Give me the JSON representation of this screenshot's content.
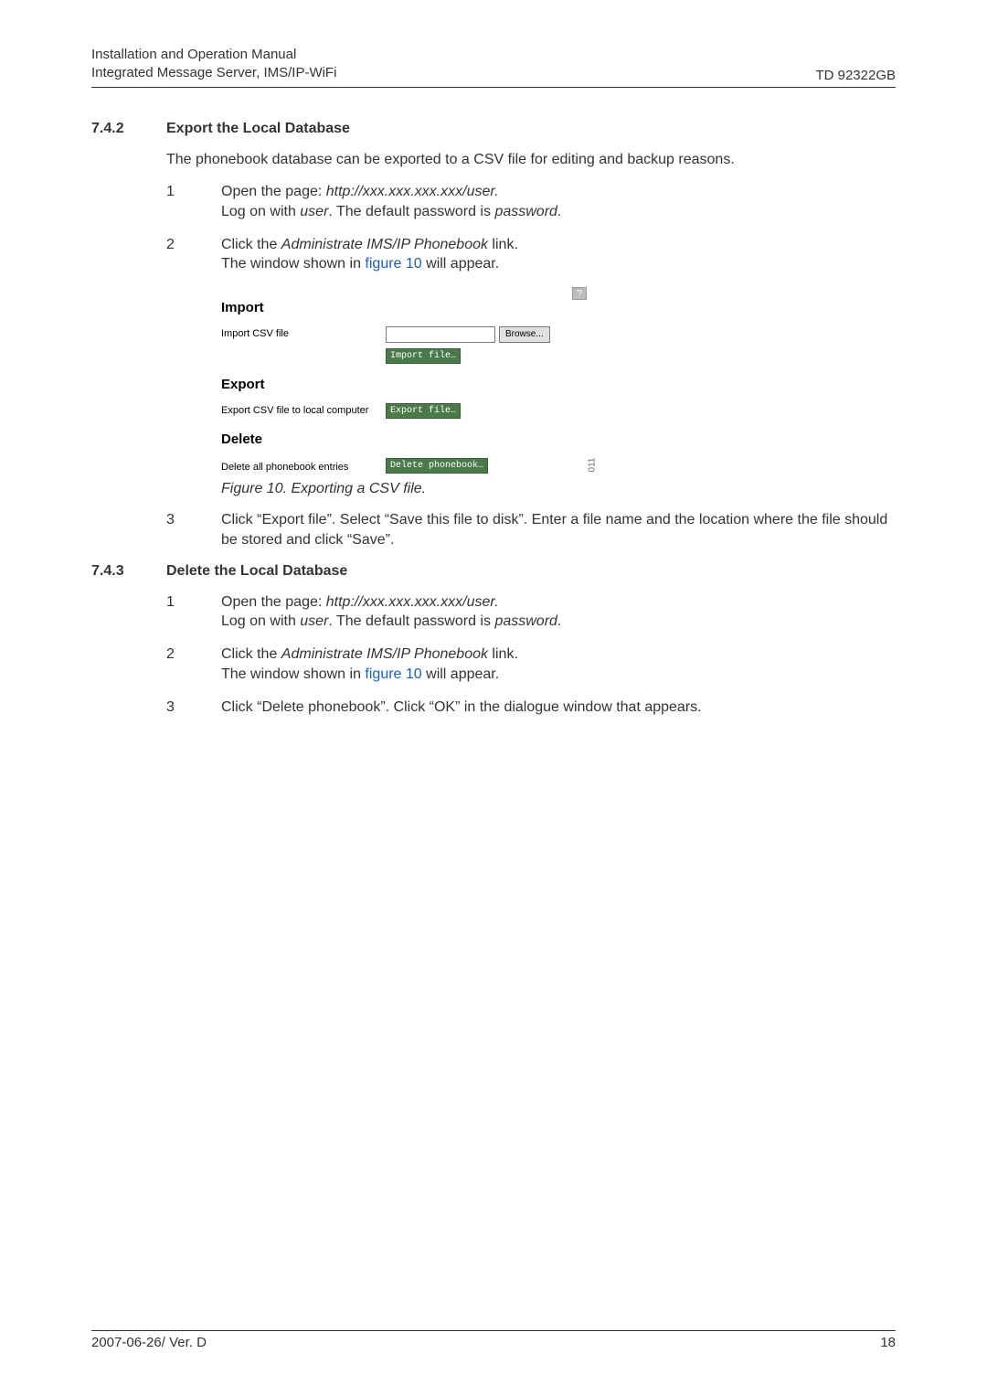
{
  "header": {
    "line1": "Installation and Operation Manual",
    "line2": "Integrated Message Server, IMS/IP-WiFi",
    "right": "TD 92322GB"
  },
  "section742": {
    "number": "7.4.2",
    "title": "Export the Local Database",
    "intro": "The phonebook database can be exported to a CSV file for editing and backup reasons.",
    "steps": [
      {
        "num": "1",
        "parts": {
          "p1": "Open the page: ",
          "url": "http://xxx.xxx.xxx.xxx/user.",
          "p2": "Log on with ",
          "user": "user",
          "p3": ". The default password is ",
          "pwd": "password",
          "p4": "."
        }
      },
      {
        "num": "2",
        "parts": {
          "p1": "Click the ",
          "link": "Administrate IMS/IP Phonebook",
          "p2": " link.",
          "p3": "The window shown in ",
          "figref": "figure 10",
          "p4": " will appear."
        }
      },
      {
        "num": "3",
        "text": "Click “Export file”. Select “Save this file to disk”. Enter a file name and the location where the file should be stored and click “Save”."
      }
    ]
  },
  "figure": {
    "import_heading": "Import",
    "qmark": "?",
    "import_label": "Import CSV file",
    "browse_btn": "Browse...",
    "import_btn": "Import file…",
    "export_heading": "Export",
    "export_label": "Export CSV file to local computer",
    "export_btn": "Export file…",
    "delete_heading": "Delete",
    "delete_label": "Delete all phonebook entries",
    "delete_btn": "Delete phonebook…",
    "side": "011",
    "caption": "Figure 10. Exporting a CSV file."
  },
  "section743": {
    "number": "7.4.3",
    "title": "Delete the Local Database",
    "steps": [
      {
        "num": "1",
        "parts": {
          "p1": "Open the page: ",
          "url": "http://xxx.xxx.xxx.xxx/user.",
          "p2": "Log on with ",
          "user": "user",
          "p3": ". The default password is ",
          "pwd": "password",
          "p4": "."
        }
      },
      {
        "num": "2",
        "parts": {
          "p1": "Click the ",
          "link": "Administrate IMS/IP Phonebook",
          "p2": " link.",
          "p3": "The window shown in ",
          "figref": "figure 10",
          "p4": " will appear."
        }
      },
      {
        "num": "3",
        "text": "Click “Delete phonebook”. Click “OK” in the dialogue window that appears."
      }
    ]
  },
  "footer": {
    "left": "2007-06-26/ Ver. D",
    "right": "18"
  }
}
